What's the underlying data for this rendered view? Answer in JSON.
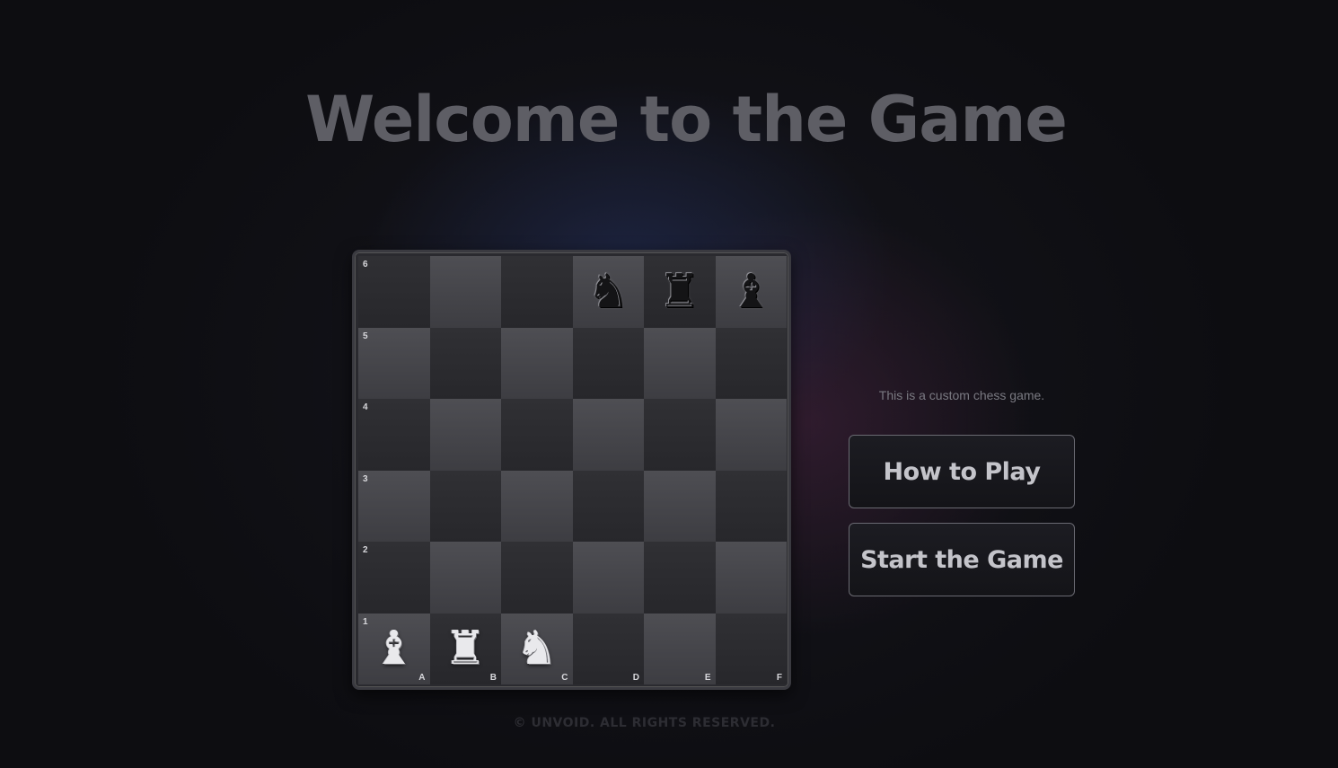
{
  "page": {
    "title": "Welcome to the Game",
    "tagline": "This is a custom chess game.",
    "footer": "© UNVOID. ALL RIGHTS RESERVED."
  },
  "buttons": {
    "how_to_play": "How to Play",
    "start_game": "Start the Game"
  },
  "board": {
    "files": [
      "A",
      "B",
      "C",
      "D",
      "E",
      "F"
    ],
    "ranks": [
      "6",
      "5",
      "4",
      "3",
      "2",
      "1"
    ],
    "pieces": [
      {
        "square": "D6",
        "type": "knight",
        "color": "black",
        "glyph": "♞"
      },
      {
        "square": "E6",
        "type": "rook",
        "color": "black",
        "glyph": "♜"
      },
      {
        "square": "F6",
        "type": "bishop",
        "color": "black",
        "glyph": "♝"
      },
      {
        "square": "A1",
        "type": "bishop",
        "color": "white",
        "glyph": "♝"
      },
      {
        "square": "B1",
        "type": "rook",
        "color": "white",
        "glyph": "♜"
      },
      {
        "square": "C1",
        "type": "knight",
        "color": "white",
        "glyph": "♞"
      }
    ]
  }
}
